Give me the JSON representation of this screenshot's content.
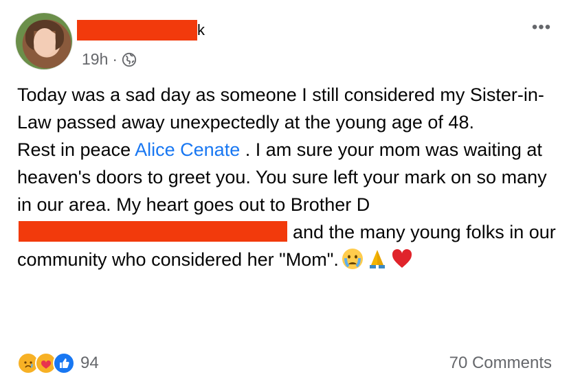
{
  "author": {
    "name_visible_suffix": "k",
    "time": "19h",
    "separator": "·",
    "audience_icon": "globe-icon"
  },
  "menu": {
    "more_label": "•••"
  },
  "post": {
    "line1": "Today was a sad day as someone I still considered my Sister-in-Law passed away unexpectedly at the young age of 48.",
    "rest_prefix": "Rest in peace ",
    "mention": "Alice Cenate",
    "rest_suffix": " . I am sure your mom was waiting at heaven's doors to greet you. You sure left your mark on so many in our area. My heart goes out to Brother D",
    "after_redaction": "and the many young folks in our community who considered her \"Mom\".",
    "emojis": [
      "crying-face-icon",
      "folded-hands-icon",
      "red-heart-icon"
    ]
  },
  "reactions": {
    "icons": [
      "sad-reaction-icon",
      "care-reaction-icon",
      "like-reaction-icon"
    ],
    "count": "94"
  },
  "comments": {
    "label": "70 Comments"
  },
  "colors": {
    "redaction": "#f23a0c",
    "mention": "#1877f2",
    "secondary_text": "#65676b"
  }
}
